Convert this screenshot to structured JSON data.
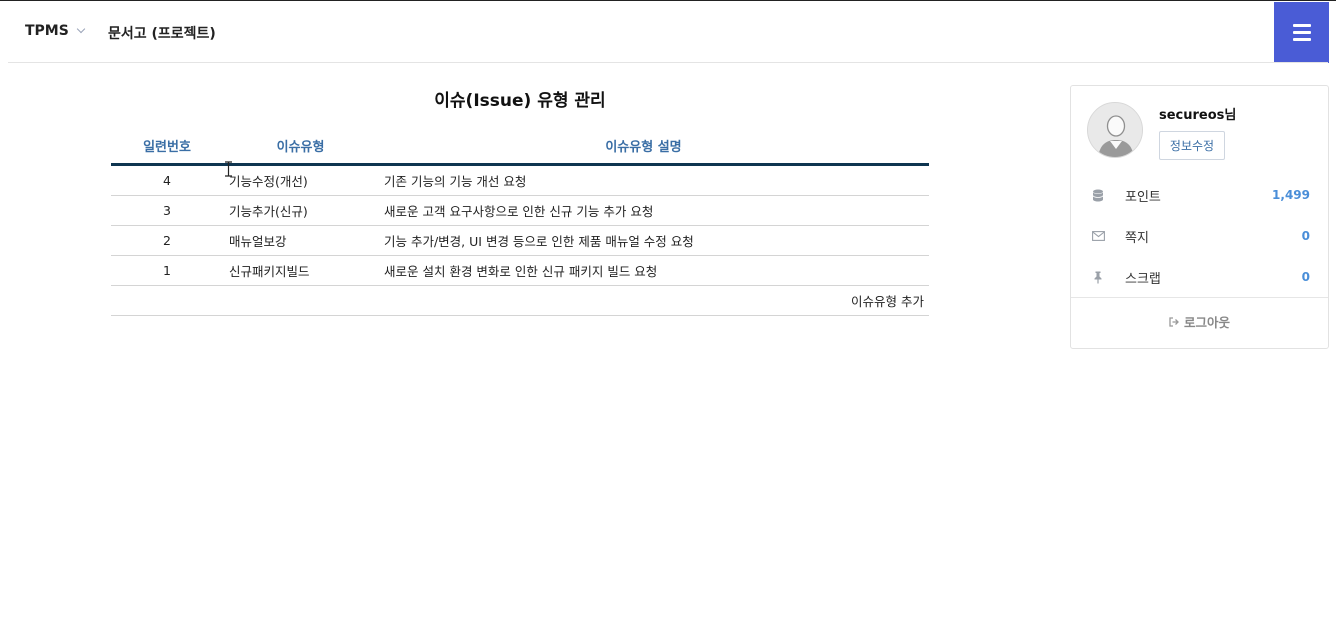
{
  "header": {
    "brand": "TPMS",
    "breadcrumb": "문서고 (프로젝트)"
  },
  "page": {
    "title": "이슈(Issue) 유형 관리"
  },
  "table": {
    "columns": [
      "일련번호",
      "이슈유형",
      "이슈유형 설명"
    ],
    "rows": [
      {
        "no": "4",
        "type": "기능수정(개선)",
        "desc": "기존 기능의 기능 개선 요청"
      },
      {
        "no": "3",
        "type": "기능추가(신규)",
        "desc": "새로운 고객 요구사항으로 인한 신규 기능 추가 요청"
      },
      {
        "no": "2",
        "type": "매뉴얼보강",
        "desc": "기능 추가/변경, UI 변경 등으로 인한 제품 매뉴얼 수정 요청"
      },
      {
        "no": "1",
        "type": "신규패키지빌드",
        "desc": "새로운 설치 환경 변화로 인한 신규 패키지 빌드 요청"
      }
    ],
    "add_label": "이슈유형 추가"
  },
  "user_panel": {
    "username": "secureos님",
    "edit_label": "정보수정",
    "stats": [
      {
        "icon": "database-icon",
        "label": "포인트",
        "value": "1,499"
      },
      {
        "icon": "envelope-icon",
        "label": "쪽지",
        "value": "0"
      },
      {
        "icon": "pin-icon",
        "label": "스크랩",
        "value": "0"
      }
    ],
    "logout_label": "로그아웃"
  },
  "colors": {
    "accent": "#4a5cd6",
    "header_text": "#3a6ea5",
    "table_rule": "#0e3550",
    "stat_value": "#4a8ed8"
  }
}
